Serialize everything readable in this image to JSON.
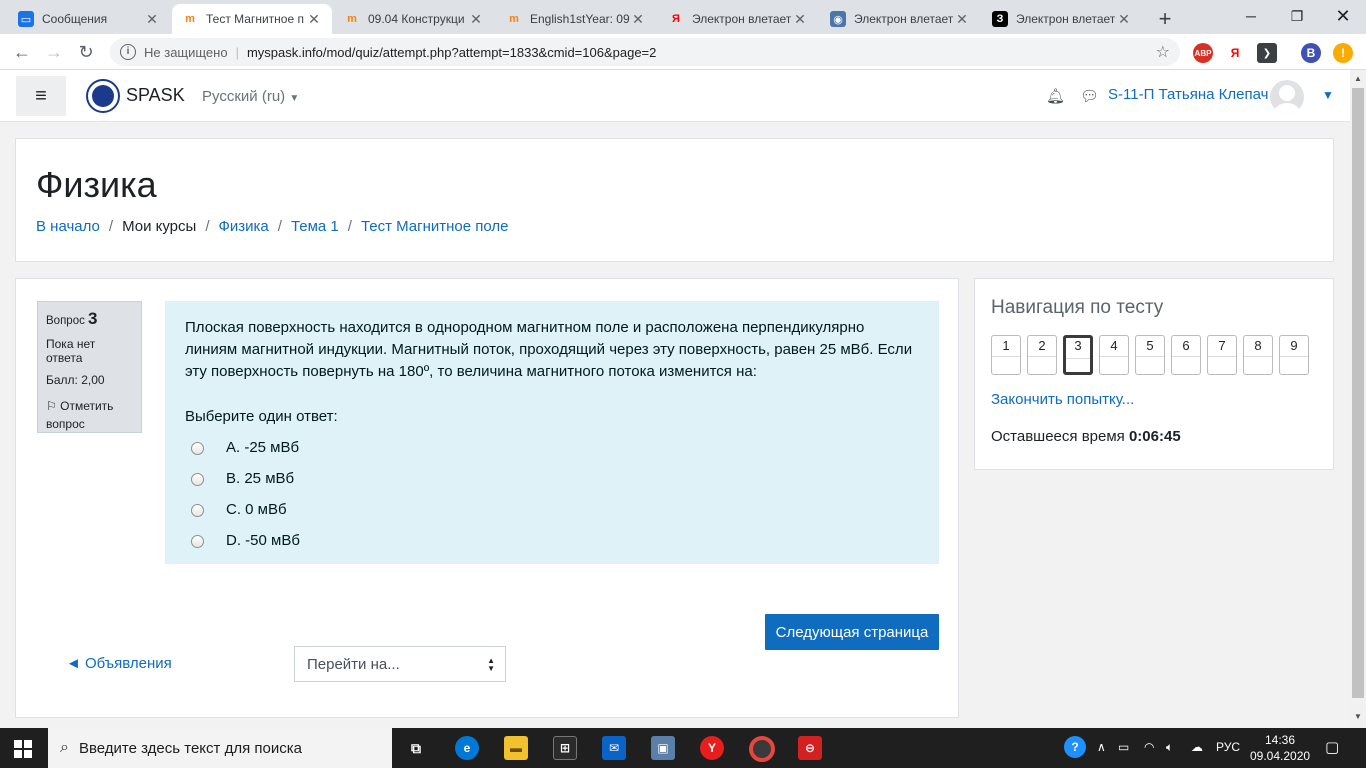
{
  "browser": {
    "tabs": [
      {
        "title": "Сообщения",
        "fav": "",
        "fav_color": "#1a73e8"
      },
      {
        "title": "Тест Магнитное п",
        "fav": "m",
        "fav_color": "#f98012"
      },
      {
        "title": "09.04 Конструкци",
        "fav": "m",
        "fav_color": "#f98012"
      },
      {
        "title": "English1stYear: 09",
        "fav": "m",
        "fav_color": "#f98012"
      },
      {
        "title": "Электрон влетает",
        "fav": "Я",
        "fav_color": "#ff0000"
      },
      {
        "title": "Электрон влетает",
        "fav": "",
        "fav_color": "#4a76a8"
      },
      {
        "title": "Электрон влетает",
        "fav": "З",
        "fav_color": "#000000"
      }
    ],
    "security_label": "Не защищено",
    "url": "myspask.info/mod/quiz/attempt.php?attempt=1833&cmid=106&page=2",
    "profile_initial": "В"
  },
  "navbar": {
    "site_name": "SPASK",
    "language": "Русский (ru)",
    "user_name": "S-11-П Татьяна Клепач"
  },
  "header": {
    "title": "Физика",
    "breadcrumbs": [
      "В начало",
      "Мои курсы",
      "Физика",
      "Тема 1",
      "Тест Магнитное поле"
    ]
  },
  "question": {
    "label": "Вопрос",
    "number": "3",
    "status": "Пока нет ответа",
    "score": "Балл: 2,00",
    "flag_label": "Отметить вопрос",
    "text": "Плоская поверхность находится в однородном магнитном поле и расположена перпендикулярно линиям магнитной индукции. Магнитный поток, проходящий через эту поверхность, равен 25 мВб. Если эту поверхность повернуть на 180º, то величина магнитного потока изменится на:",
    "prompt": "Выберите один ответ:",
    "answers": [
      "A. -25 мВб",
      "B. 25 мВб",
      "C. 0 мВб",
      "D. -50 мВб"
    ]
  },
  "controls": {
    "next_label": "Следующая страница",
    "prev_link": "◄ Объявления",
    "jump_placeholder": "Перейти на..."
  },
  "quiz_nav": {
    "title": "Навигация по тесту",
    "buttons": [
      "1",
      "2",
      "3",
      "4",
      "5",
      "6",
      "7",
      "8",
      "9"
    ],
    "current": "3",
    "finish_label": "Закончить попытку...",
    "time_label": "Оставшееся время",
    "time_value": "0:06:45"
  },
  "taskbar": {
    "search_placeholder": "Введите здесь текст для поиска",
    "lang": "РУС",
    "time": "14:36",
    "date": "09.04.2020"
  },
  "colors": {
    "accent": "#0f6cbf",
    "question_bg": "#def2f8"
  }
}
